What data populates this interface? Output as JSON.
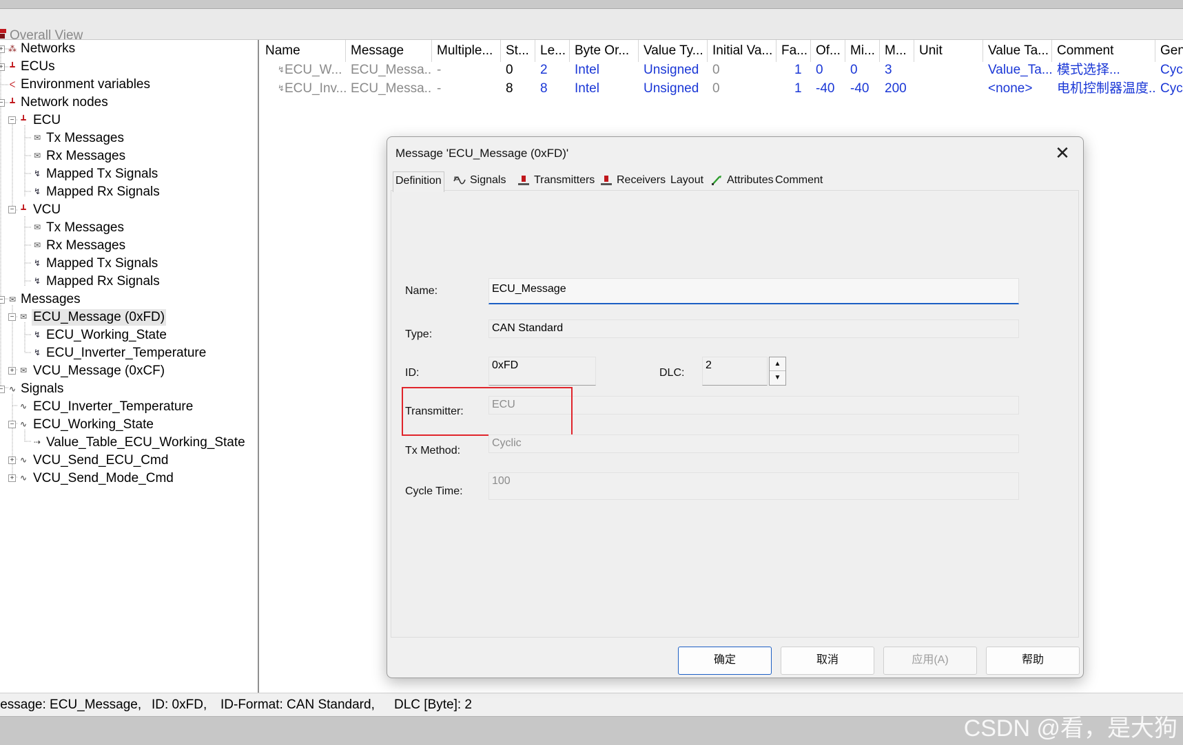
{
  "window": {
    "title": "Overall View"
  },
  "tree": {
    "items": [
      {
        "label": "Networks"
      },
      {
        "label": "ECUs"
      },
      {
        "label": "Environment variables"
      },
      {
        "label": "Network nodes"
      },
      {
        "label": "ECU"
      },
      {
        "label": "Tx Messages"
      },
      {
        "label": "Rx Messages"
      },
      {
        "label": "Mapped Tx Signals"
      },
      {
        "label": "Mapped Rx Signals"
      },
      {
        "label": "VCU"
      },
      {
        "label": "Tx Messages"
      },
      {
        "label": "Rx Messages"
      },
      {
        "label": "Mapped Tx Signals"
      },
      {
        "label": "Mapped Rx Signals"
      },
      {
        "label": "Messages"
      },
      {
        "label": "ECU_Message (0xFD)"
      },
      {
        "label": "ECU_Working_State"
      },
      {
        "label": "ECU_Inverter_Temperature"
      },
      {
        "label": "VCU_Message (0xCF)"
      },
      {
        "label": "Signals"
      },
      {
        "label": "ECU_Inverter_Temperature"
      },
      {
        "label": "ECU_Working_State"
      },
      {
        "label": "Value_Table_ECU_Working_State"
      },
      {
        "label": "VCU_Send_ECU_Cmd"
      },
      {
        "label": "VCU_Send_Mode_Cmd"
      }
    ]
  },
  "table": {
    "headers": [
      "Name",
      "Message",
      "Multiple...",
      "St...",
      "Le...",
      "Byte Or...",
      "Value Ty...",
      "Initial Va...",
      "Fa...",
      "Of...",
      "Mi...",
      "M...",
      "Unit",
      "Value Ta...",
      "Comment",
      "Gen"
    ],
    "rows": [
      [
        "ECU_W...",
        "ECU_Messa...",
        "-",
        "0",
        "2",
        "Intel",
        "Unsigned",
        "0",
        "1",
        "0",
        "0",
        "3",
        "",
        "Value_Ta...",
        "模式选择...",
        "Cyc"
      ],
      [
        "ECU_Inv...",
        "ECU_Messa...",
        "-",
        "8",
        "8",
        "Intel",
        "Unsigned",
        "0",
        "1",
        "-40",
        "-40",
        "200",
        "",
        "<none>",
        "电机控制器温度...",
        "Cyc"
      ]
    ]
  },
  "status": {
    "message": "lessage: ECU_Message,",
    "id": "ID: 0xFD,",
    "id_format": "ID-Format: CAN Standard,",
    "dlc": "DLC [Byte]: 2"
  },
  "watermark": "CSDN @看，是大狗",
  "dialog": {
    "title": "Message 'ECU_Message (0xFD)'",
    "tabs": [
      "Definition",
      "Signals",
      "Transmitters",
      "Receivers",
      "Layout",
      "Attributes",
      "Comment"
    ],
    "fields": {
      "name_label": "Name:",
      "name_value": "ECU_Message",
      "type_label": "Type:",
      "type_value": "CAN Standard",
      "id_label": "ID:",
      "id_value": "0xFD",
      "dlc_label": "DLC:",
      "dlc_value": "2",
      "transmitter_label": "Transmitter:",
      "transmitter_value": "ECU",
      "tx_method_label": "Tx Method:",
      "tx_method_value": "Cyclic",
      "cycle_time_label": "Cycle Time:",
      "cycle_time_value": "100"
    },
    "buttons": {
      "ok": "确定",
      "cancel": "取消",
      "apply": "应用(A)",
      "help": "帮助"
    }
  },
  "colors": {
    "link_blue": "#1a37d6",
    "highlight_red": "#e0242b",
    "focus_blue": "#1c5fc4"
  }
}
